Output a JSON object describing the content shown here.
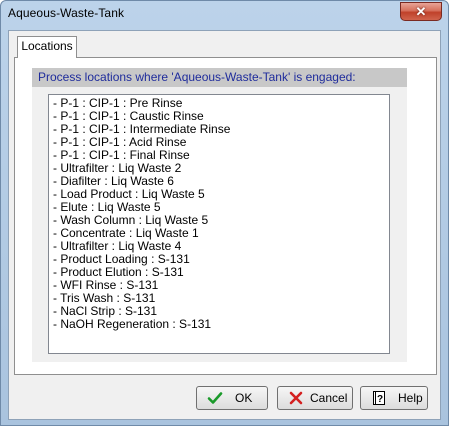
{
  "window": {
    "title": "Aqueous-Waste-Tank",
    "close_glyph": "✕"
  },
  "tabs": [
    {
      "label": "Locations"
    }
  ],
  "group": {
    "header": "Process locations where 'Aqueous-Waste-Tank' is engaged:"
  },
  "locations": [
    "- P-1 : CIP-1 : Pre Rinse",
    "- P-1 : CIP-1 : Caustic Rinse",
    "- P-1 : CIP-1 : Intermediate Rinse",
    "- P-1 : CIP-1 : Acid Rinse",
    "- P-1 : CIP-1 : Final Rinse",
    "- Ultrafilter : Liq Waste 2",
    "- Diafilter : Liq Waste 6",
    "- Load Product : Liq Waste 5",
    "- Elute : Liq Waste 5",
    "- Wash Column : Liq Waste 5",
    "- Concentrate : Liq Waste 1",
    "- Ultrafilter : Liq Waste 4",
    "- Product Loading : S-131",
    "- Product Elution : S-131",
    "- WFI Rinse : S-131",
    "- Tris Wash : S-131",
    "- NaCl Strip : S-131",
    "- NaOH Regeneration : S-131"
  ],
  "buttons": {
    "ok_label": "OK",
    "cancel_label": "Cancel",
    "help_label": "Help"
  },
  "icons": {
    "ok": "check-icon",
    "cancel": "x-icon",
    "help": "help-book-icon"
  },
  "colors": {
    "header_text": "#1f2c9c",
    "ok_check": "#1a9a2a",
    "cancel_x": "#d42020"
  }
}
